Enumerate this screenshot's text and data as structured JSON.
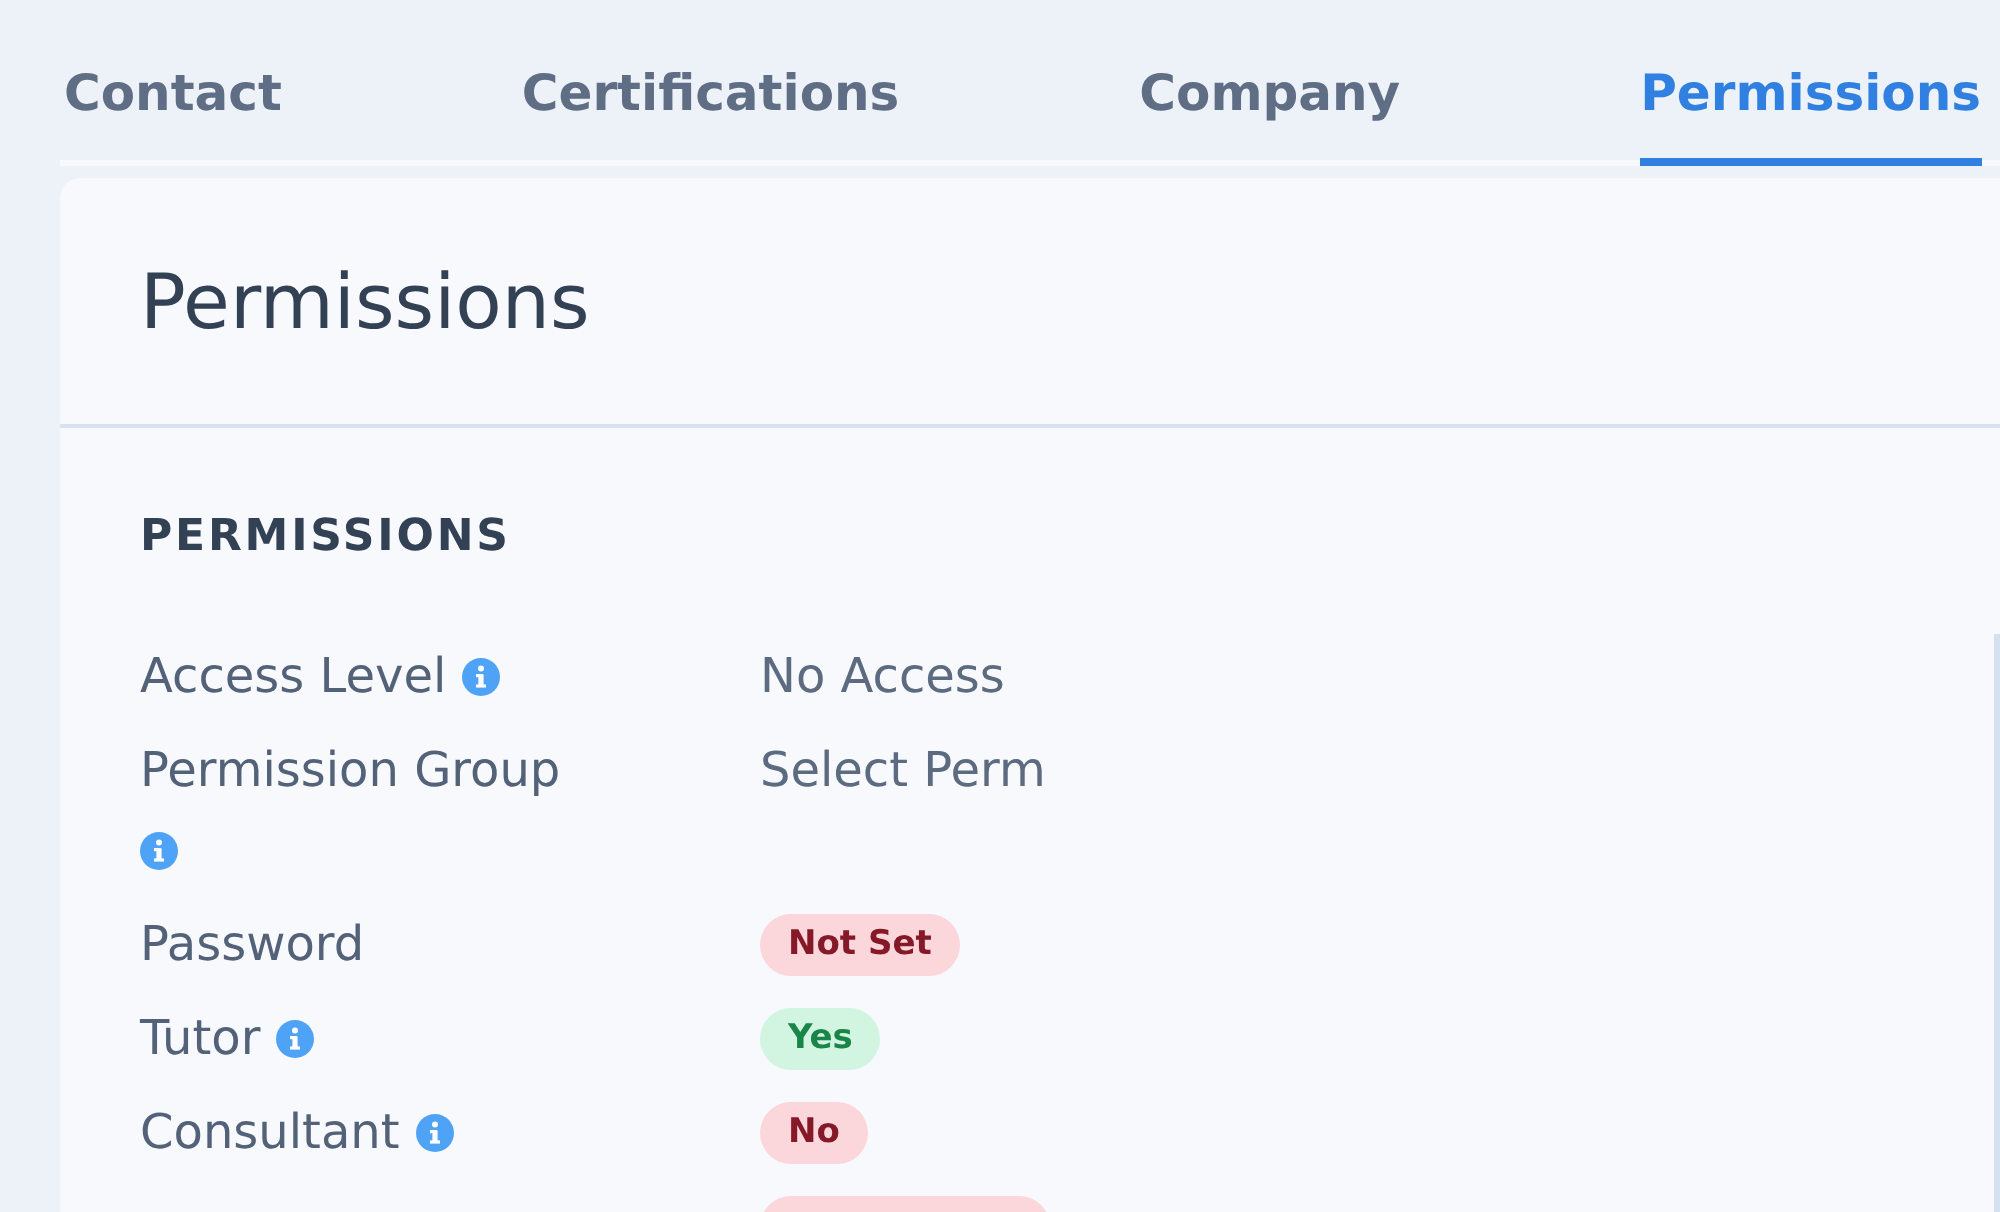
{
  "tabs": [
    {
      "label": "Contact",
      "selected": false
    },
    {
      "label": "Certifications",
      "selected": false
    },
    {
      "label": "Company",
      "selected": false
    },
    {
      "label": "Permissions",
      "selected": true
    }
  ],
  "panel": {
    "title": "Permissions",
    "section": {
      "heading": "PERMISSIONS",
      "rows": [
        {
          "label": "Access Level",
          "info": true,
          "kind": "text",
          "value": "No Access"
        },
        {
          "label": "Permission Group",
          "info": true,
          "kind": "text",
          "value": "Select Perm"
        },
        {
          "label": "Password",
          "info": false,
          "kind": "badge",
          "value": "Not Set",
          "color": "#fbd6db"
        },
        {
          "label": "Tutor",
          "info": true,
          "kind": "badge",
          "value": "Yes",
          "color": "#d2f5e1"
        },
        {
          "label": "Consultant",
          "info": true,
          "kind": "badge",
          "value": "No",
          "color": "#fbd6db"
        },
        {
          "kind": "badge",
          "color": "#fbd6db"
        }
      ]
    }
  }
}
